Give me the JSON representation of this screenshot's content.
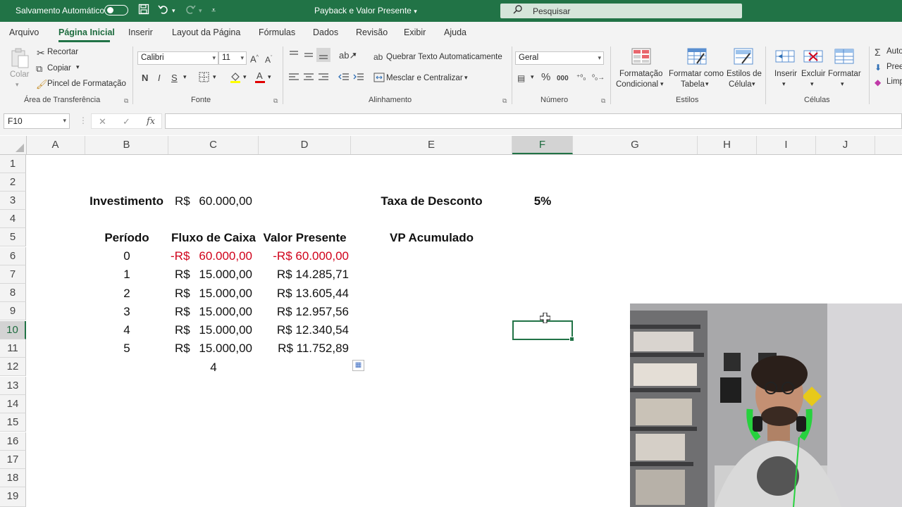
{
  "titlebar": {
    "autosave_label": "Salvamento Automático",
    "document_title": "Payback e Valor Presente",
    "search_placeholder": "Pesquisar"
  },
  "menu_tabs": [
    "Arquivo",
    "Página Inicial",
    "Inserir",
    "Layout da Página",
    "Fórmulas",
    "Dados",
    "Revisão",
    "Exibir",
    "Ajuda"
  ],
  "active_tab": "Página Inicial",
  "ribbon": {
    "clipboard": {
      "paste": "Colar",
      "cut": "Recortar",
      "copy": "Copiar",
      "format_painter": "Pincel de Formatação",
      "group": "Área de Transferência"
    },
    "font": {
      "font_name": "Calibri",
      "font_size": "11",
      "bold": "N",
      "italic": "I",
      "underline": "S",
      "group": "Fonte"
    },
    "alignment": {
      "wrap_text": "Quebrar Texto Automaticamente",
      "merge_center": "Mesclar e Centralizar",
      "group": "Alinhamento"
    },
    "number": {
      "format": "Geral",
      "percent": "%",
      "thousands": "000",
      "group": "Número"
    },
    "styles": {
      "conditional_1": "Formatação",
      "conditional_2": "Condicional",
      "table_1": "Formatar como",
      "table_2": "Tabela",
      "cell_styles_1": "Estilos de",
      "cell_styles_2": "Célula",
      "group": "Estilos"
    },
    "cells": {
      "insert": "Inserir",
      "delete": "Excluir",
      "format": "Formatar",
      "group": "Células"
    },
    "editing": {
      "autosum": "Auto",
      "fill": "Pree",
      "clear": "Limp"
    }
  },
  "formula_bar": {
    "name_box": "F10",
    "fx": "fx",
    "content": ""
  },
  "columns": [
    "A",
    "B",
    "C",
    "D",
    "E",
    "F",
    "G",
    "H",
    "I",
    "J"
  ],
  "selected_column": "F",
  "rows": [
    "1",
    "2",
    "3",
    "4",
    "5",
    "6",
    "7",
    "8",
    "9",
    "10",
    "11",
    "12",
    "13",
    "14",
    "15",
    "16",
    "17",
    "18",
    "19"
  ],
  "selected_row": "10",
  "cells": {
    "investimento_label": "Investimento",
    "investimento_currency": "R$",
    "investimento_value": "60.000,00",
    "taxa_label": "Taxa de Desconto",
    "taxa_value": "5%",
    "headers": {
      "periodo": "Período",
      "fluxo": "Fluxo de Caixa",
      "valor_presente": "Valor Presente",
      "vp_acumulado": "VP Acumulado"
    },
    "data_rows": [
      {
        "periodo": "0",
        "fluxo_cur": "-R$",
        "fluxo_val": "60.000,00",
        "vp": "-R$ 60.000,00",
        "negative": true
      },
      {
        "periodo": "1",
        "fluxo_cur": "R$",
        "fluxo_val": "15.000,00",
        "vp": "R$ 14.285,71",
        "negative": false
      },
      {
        "periodo": "2",
        "fluxo_cur": "R$",
        "fluxo_val": "15.000,00",
        "vp": "R$ 13.605,44",
        "negative": false
      },
      {
        "periodo": "3",
        "fluxo_cur": "R$",
        "fluxo_val": "15.000,00",
        "vp": "R$ 12.957,56",
        "negative": false
      },
      {
        "periodo": "4",
        "fluxo_cur": "R$",
        "fluxo_val": "15.000,00",
        "vp": "R$ 12.340,54",
        "negative": false
      },
      {
        "periodo": "5",
        "fluxo_cur": "R$",
        "fluxo_val": "15.000,00",
        "vp": "R$ 11.752,89",
        "negative": false
      }
    ],
    "c12_value": "4"
  },
  "colors": {
    "excel_green": "#217346",
    "negative_red": "#d0021b"
  }
}
